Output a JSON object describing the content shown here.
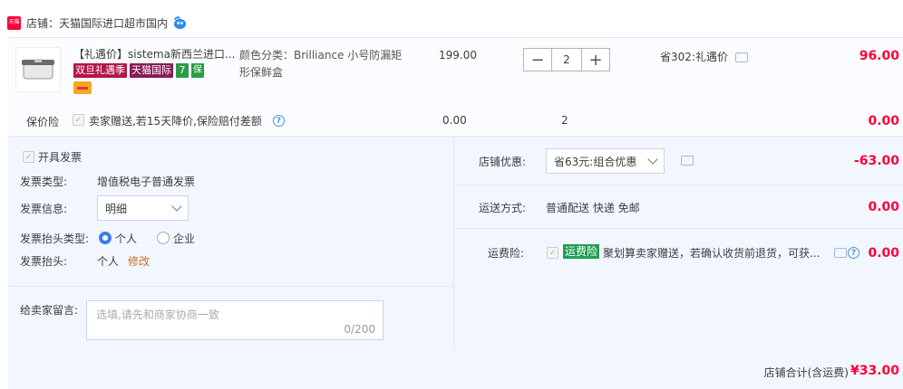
{
  "store": {
    "badge_text": "天猫",
    "label": "店铺：天猫国际进口超市国内"
  },
  "item": {
    "title": "【礼遇价】sistema新西兰进口...",
    "tags": [
      "双旦礼遇季",
      "天猫国际",
      "7",
      "保"
    ],
    "sku_line1": "颜色分类：Brilliance 小号防漏矩",
    "sku_line2": "形保鲜盒",
    "unit_price": "199.00",
    "quantity": "2",
    "minus": "−",
    "plus": "+",
    "save_text": "省302:礼遇价",
    "total": "96.00"
  },
  "insurance": {
    "label": "保价险",
    "text": "卖家赠送,若15天降价,保险赔付差额",
    "price": "0.00",
    "qty": "2",
    "total": "0.00"
  },
  "invoice": {
    "open_label": "开具发票",
    "type_label": "发票类型:",
    "type_value": "增值税电子普通发票",
    "info_label": "发票信息:",
    "info_value": "明细",
    "title_type_label": "发票抬头类型:",
    "option_personal": "个人",
    "option_company": "企业",
    "title_label": "发票抬头:",
    "title_value": "个人",
    "edit_link": "修改"
  },
  "message": {
    "label": "给卖家留言:",
    "placeholder": "选填,请先和商家协商一致",
    "count": "0/200"
  },
  "discount": {
    "label": "店铺优惠:",
    "selected": "省63元:组合优惠",
    "amount": "-63.00"
  },
  "shipping": {
    "label": "运送方式:",
    "value": "普通配送 快递 免邮",
    "amount": "0.00"
  },
  "shipping_insurance": {
    "label": "运费险:",
    "tag": "运费险",
    "text": "聚划算卖家赠送，若确认收货前退货，可获...",
    "amount": "0.00"
  },
  "footer": {
    "label": "店铺合计(含运费)",
    "total": "¥33.00"
  },
  "colors": {
    "accent_red": "#ff0036",
    "link_blue": "#3d7eea",
    "panel_bg": "#f2f7ff"
  }
}
